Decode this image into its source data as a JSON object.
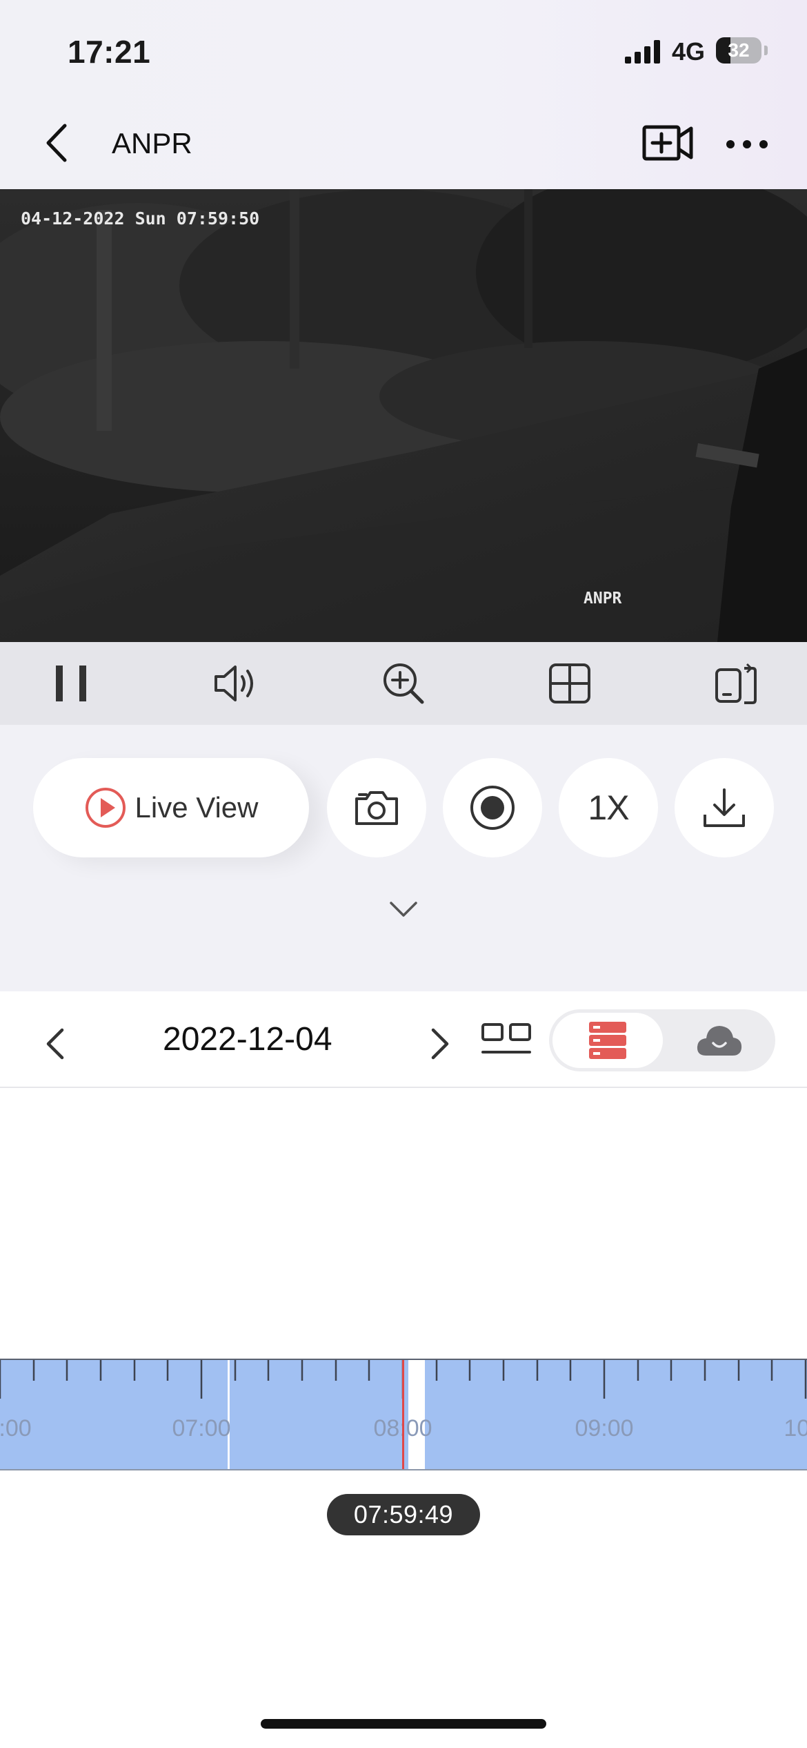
{
  "status_bar": {
    "time": "17:21",
    "network": "4G",
    "battery_level": 32,
    "battery_text": "32",
    "signal_icon": "signal-bars-icon"
  },
  "nav": {
    "title": "ANPR",
    "back_icon": "chevron-left-icon",
    "record_icon": "video-camera-plus-icon",
    "more_icon": "more-horizontal-icon"
  },
  "video": {
    "osd_timestamp": "04-12-2022 Sun 07:59:50",
    "osd_camera_name": "ANPR"
  },
  "toolbar": {
    "items": [
      {
        "icon": "pause-icon"
      },
      {
        "icon": "speaker-icon"
      },
      {
        "icon": "zoom-in-icon"
      },
      {
        "icon": "grid-layout-icon"
      },
      {
        "icon": "rotate-screen-icon"
      }
    ]
  },
  "controls": {
    "live_view_label": "Live View",
    "speed_label": "1X",
    "icons": [
      "play-circle-icon",
      "camera-snapshot-icon",
      "record-icon",
      "download-icon",
      "chevron-down-icon"
    ]
  },
  "playback": {
    "date": "2022-12-04",
    "selected_source": "device",
    "source_icons": [
      "storage-server-icon",
      "cloud-icon"
    ],
    "timeline_labels": [
      ":00",
      "07:00",
      "08:00",
      "09:00",
      "10:"
    ],
    "current_time": "07:59:49"
  },
  "colors": {
    "accent": "#e35b57",
    "timeline_fill": "#a1c0f2",
    "cursor": "#e04848"
  }
}
